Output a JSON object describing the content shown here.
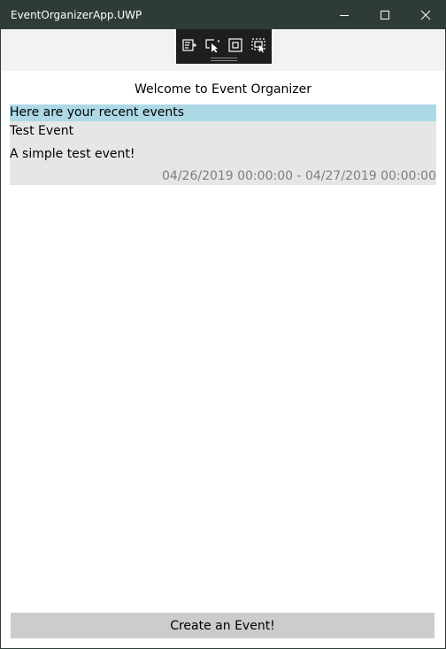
{
  "window": {
    "title": "EventOrganizerApp.UWP",
    "controls": [
      "minimize-icon",
      "maximize-icon",
      "close-icon"
    ]
  },
  "debug_toolbar": {
    "tools": [
      "live-visual-tree-icon",
      "select-element-icon",
      "display-layout-adorners-icon",
      "track-focused-element-icon"
    ]
  },
  "main": {
    "heading": "Welcome to Event Organizer",
    "recent_header": "Here are your recent events",
    "events": [
      {
        "title": "Test Event",
        "description": "A simple test event!",
        "dates": "04/26/2019 00:00:00 - 04/27/2019 00:00:00"
      }
    ],
    "create_button": "Create an Event!"
  },
  "colors": {
    "titlebar": "#2f3c35",
    "recent_header_bg": "#add8e6",
    "event_bg": "#e6e6e6",
    "button_bg": "#cccccc",
    "date_text": "#7f7f7f"
  }
}
